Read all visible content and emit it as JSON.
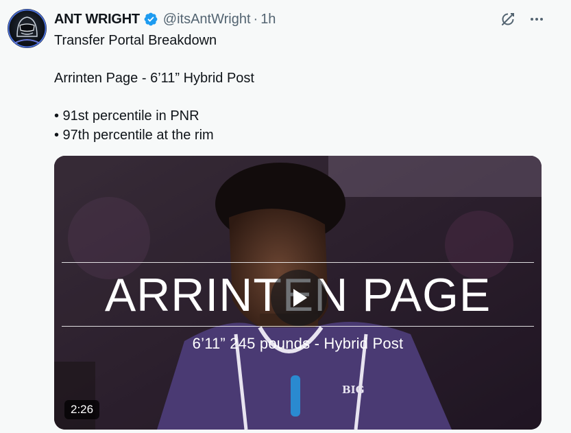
{
  "author": {
    "display_name": "ANT WRIGHT",
    "handle": "@itsAntWright",
    "separator": "·",
    "time": "1h",
    "verified": true,
    "avatar_icon": "masked-avatar"
  },
  "icons": {
    "grok": "grok-icon",
    "more": "more-options-icon",
    "verified": "verified-badge-icon",
    "play": "play-icon"
  },
  "tweet": {
    "text": "Transfer Portal Breakdown\n\nArrinten Page - 6’11” Hybrid Post\n\n• 91st percentile in PNR\n• 97th percentile at the rim"
  },
  "media": {
    "type": "video",
    "title": "ARRINTEN PAGE",
    "subtitle": "6’11” 245 pounds - Hybrid Post",
    "duration": "2:26",
    "jersey_text": "BIG"
  },
  "colors": {
    "background": "#f7f9f9",
    "text": "#0f1419",
    "secondary_text": "#536471",
    "verified_blue": "#1d9bf0"
  }
}
